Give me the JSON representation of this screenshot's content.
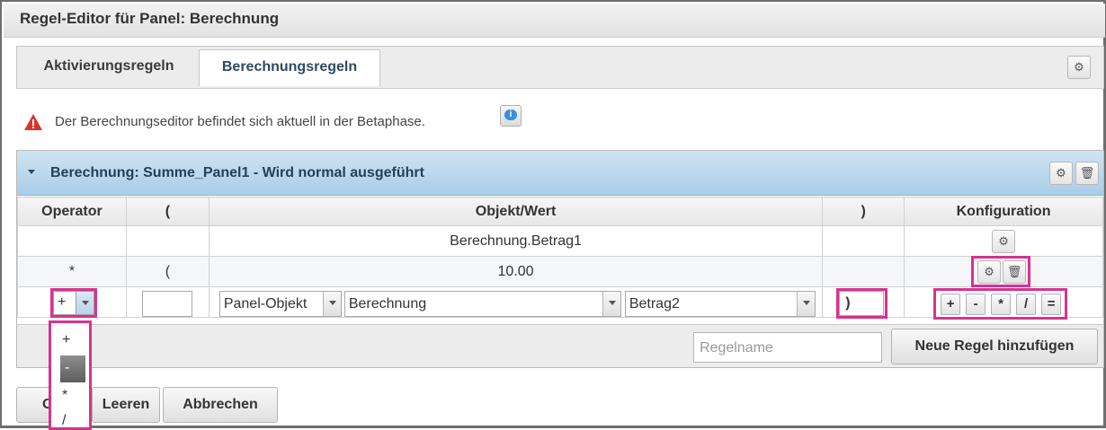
{
  "window": {
    "title": "Regel-Editor für Panel: Berechnung"
  },
  "tabs": [
    {
      "label": "Aktivierungsregeln",
      "active": false
    },
    {
      "label": "Berechnungsregeln",
      "active": true
    }
  ],
  "notice": {
    "text": "Der Berechnungseditor befindet sich aktuell in der Betaphase."
  },
  "panel": {
    "title": "Berechnung:  Summe_Panel1 - Wird normal ausgeführt",
    "columns": [
      "Operator",
      "(",
      "Objekt/Wert",
      ")",
      "Konfiguration"
    ],
    "rows": [
      {
        "operator": "",
        "open_paren": "",
        "value": "Berechnung.Betrag1",
        "close_paren": ""
      },
      {
        "operator": "*",
        "open_paren": "(",
        "value": "10.00",
        "close_paren": ""
      }
    ],
    "edit_row": {
      "operator_selected": "+",
      "open_paren_value": "",
      "object_type": "Panel-Objekt",
      "panel": "Berechnung",
      "field": "Betrag2",
      "close_paren_value": ")",
      "operator_buttons": [
        "+",
        "-",
        "*",
        "/",
        "="
      ]
    },
    "rulename_placeholder": "Regelname",
    "add_rule_label": "Neue Regel hinzufügen"
  },
  "operator_dropdown": {
    "options": [
      "+",
      "-",
      "*",
      "/"
    ],
    "highlighted": "-"
  },
  "bottom_buttons": {
    "ok": "OK",
    "clear": "Leeren",
    "cancel": "Abbrechen"
  },
  "colors": {
    "highlight": "#d6338f",
    "header_blue": "#a9cde6"
  }
}
